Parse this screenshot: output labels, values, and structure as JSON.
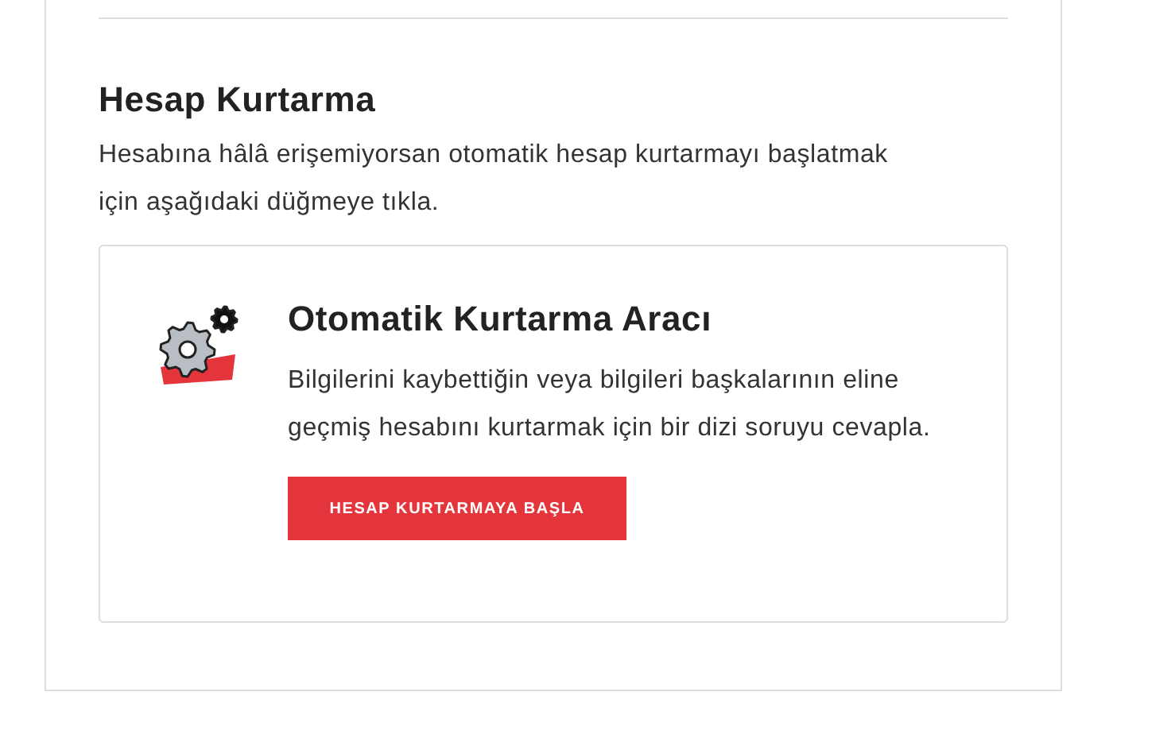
{
  "section": {
    "title": "Hesap Kurtarma",
    "description": "Hesabına hâlâ erişemiyorsan otomatik hesap kurtarmayı başlatmak için aşağıdaki düğmeye tıkla."
  },
  "card": {
    "title": "Otomatik Kurtarma Aracı",
    "description": "Bilgilerini kaybettiğin veya bilgileri başkalarının eline geçmiş hesabını kurtarmak için bir dizi soruyu cevapla.",
    "button": "HESAP KURTARMAYA BAŞLA"
  }
}
